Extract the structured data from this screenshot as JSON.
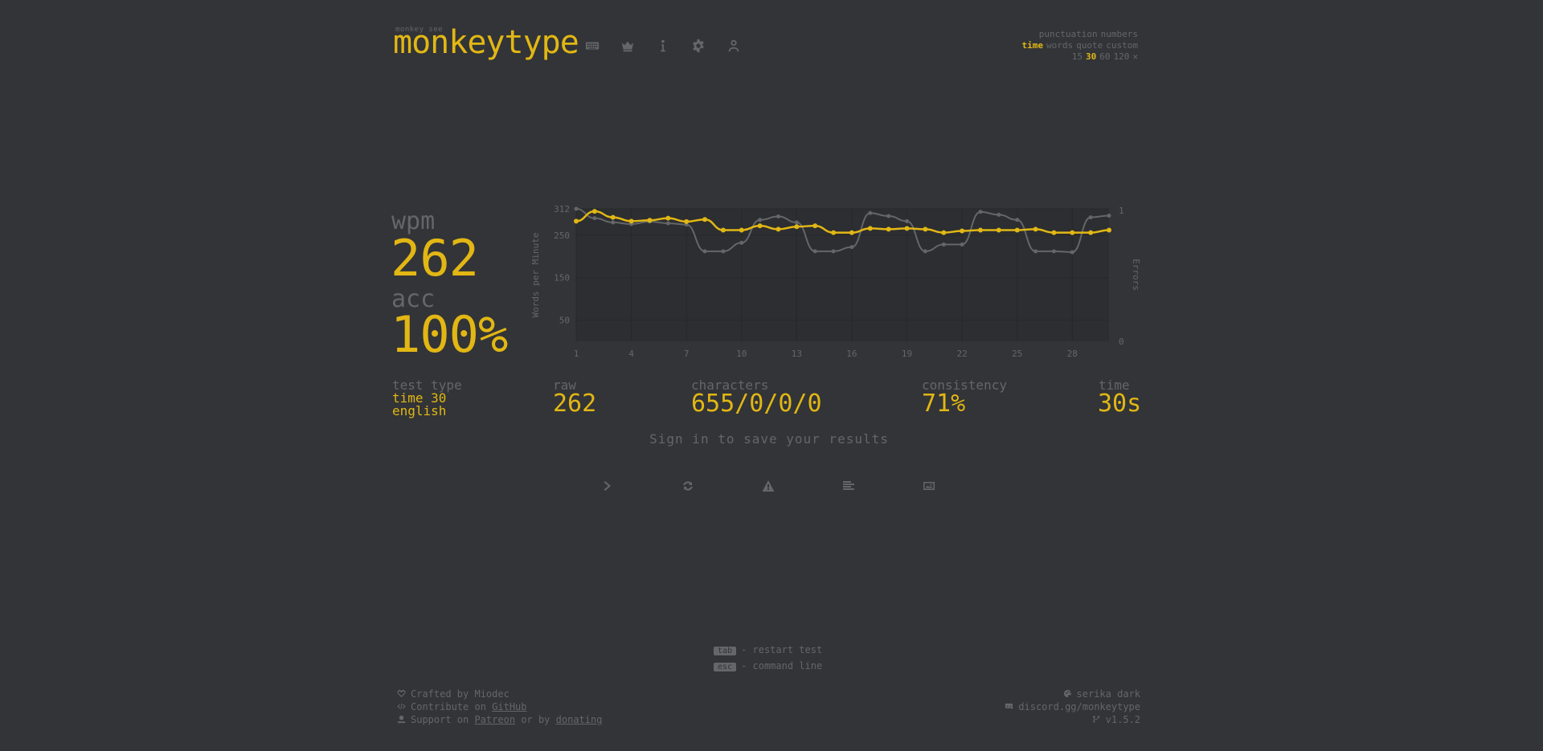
{
  "header": {
    "logo_top": "monkey see",
    "logo": "monkeytype",
    "nav_icons": [
      "keyboard-icon",
      "crown-icon",
      "info-icon",
      "gear-icon",
      "user-icon"
    ]
  },
  "config": {
    "row1": [
      "punctuation",
      "numbers"
    ],
    "row2": [
      "time",
      "words",
      "quote",
      "custom"
    ],
    "row2_active": "time",
    "row3": [
      "15",
      "30",
      "60",
      "120"
    ],
    "row3_active": "30"
  },
  "result": {
    "wpm_label": "wpm",
    "wpm": "262",
    "acc_label": "acc",
    "acc": "100%",
    "test_type_label": "test type",
    "test_type_line1": "time 30",
    "test_type_line2": "english",
    "raw_label": "raw",
    "raw": "262",
    "characters_label": "characters",
    "characters": "655/0/0/0",
    "consistency_label": "consistency",
    "consistency": "71%",
    "time_label": "time",
    "time": "30s",
    "signin": "Sign in to save your results"
  },
  "actions": [
    "next-test",
    "restart-test",
    "report",
    "word-history",
    "screenshot"
  ],
  "hints": {
    "tab_key": "tab",
    "tab_text": "- restart test",
    "esc_key": "esc",
    "esc_text": "- command line"
  },
  "footer": {
    "crafted": "Crafted by Miodec",
    "contribute_prefix": "Contribute on ",
    "github": "GitHub",
    "support_prefix": "Support on ",
    "patreon": "Patreon",
    "support_mid": " or by ",
    "donating": "donating",
    "theme": "serika dark",
    "discord": "discord.gg/monkeytype",
    "version": "v1.5.2"
  },
  "colors": {
    "background": "#323437",
    "chart_bg": "#2c2e31",
    "main": "#e2b714",
    "sub": "#646669"
  },
  "chart_data": {
    "type": "line",
    "x": [
      1,
      2,
      3,
      4,
      5,
      6,
      7,
      8,
      9,
      10,
      11,
      12,
      13,
      14,
      15,
      16,
      17,
      18,
      19,
      20,
      21,
      22,
      23,
      24,
      25,
      26,
      27,
      28,
      29,
      30
    ],
    "x_ticks": [
      "1",
      "4",
      "7",
      "10",
      "13",
      "16",
      "19",
      "22",
      "25",
      "28"
    ],
    "y_ticks": [
      "312",
      "250",
      "150",
      "50"
    ],
    "y2_ticks": [
      "1",
      "0"
    ],
    "ylabel": "Words per Minute",
    "y2label": "Errors",
    "ylim": [
      0,
      312
    ],
    "series": [
      {
        "name": "",
        "color": "#646669",
        "values": [
          312,
          290,
          280,
          276,
          282,
          278,
          275,
          212,
          212,
          232,
          286,
          294,
          280,
          212,
          212,
          222,
          302,
          295,
          283,
          212,
          228,
          228,
          305,
          298,
          286,
          212,
          212,
          210,
          292,
          296
        ]
      },
      {
        "name": "",
        "color": "#e2b714",
        "values": [
          283,
          306,
          292,
          283,
          285,
          290,
          282,
          287,
          262,
          262,
          272,
          264,
          270,
          272,
          256,
          256,
          266,
          264,
          266,
          264,
          256,
          260,
          262,
          262,
          262,
          264,
          256,
          256,
          256,
          262
        ]
      }
    ]
  }
}
